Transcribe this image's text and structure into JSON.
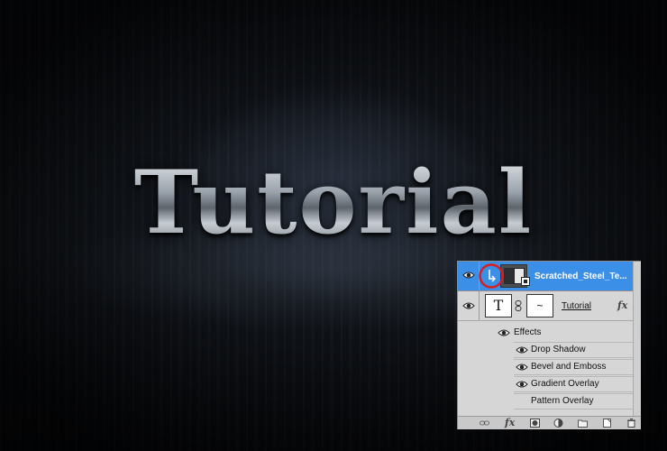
{
  "canvas": {
    "text": "Tutorial"
  },
  "layers_panel": {
    "layers": [
      {
        "name": "Scratched_Steel_Te...",
        "selected": true,
        "visible": true,
        "type": "smart-object",
        "clipping_mask_indicator": true
      },
      {
        "name": "Tutorial",
        "selected": false,
        "visible": true,
        "type": "text",
        "thumb_glyph": "T",
        "mask_glyph": "~",
        "has_fx": true,
        "fx_label": "fx"
      }
    ],
    "effects_header": "Effects",
    "effects": [
      {
        "name": "Drop Shadow",
        "visible": true
      },
      {
        "name": "Bevel and Emboss",
        "visible": true
      },
      {
        "name": "Gradient Overlay",
        "visible": true
      },
      {
        "name": "Pattern Overlay",
        "visible": false
      }
    ],
    "bottom_icons": [
      "link-icon",
      "fx-icon",
      "mask-icon",
      "adjustment-icon",
      "folder-icon",
      "new-layer-icon",
      "trash-icon"
    ],
    "bottom_fx_label": "fx"
  },
  "colors": {
    "selection": "#3b8fe6",
    "annotation_circle": "#d62020",
    "panel_bg": "#d6d6d6"
  }
}
